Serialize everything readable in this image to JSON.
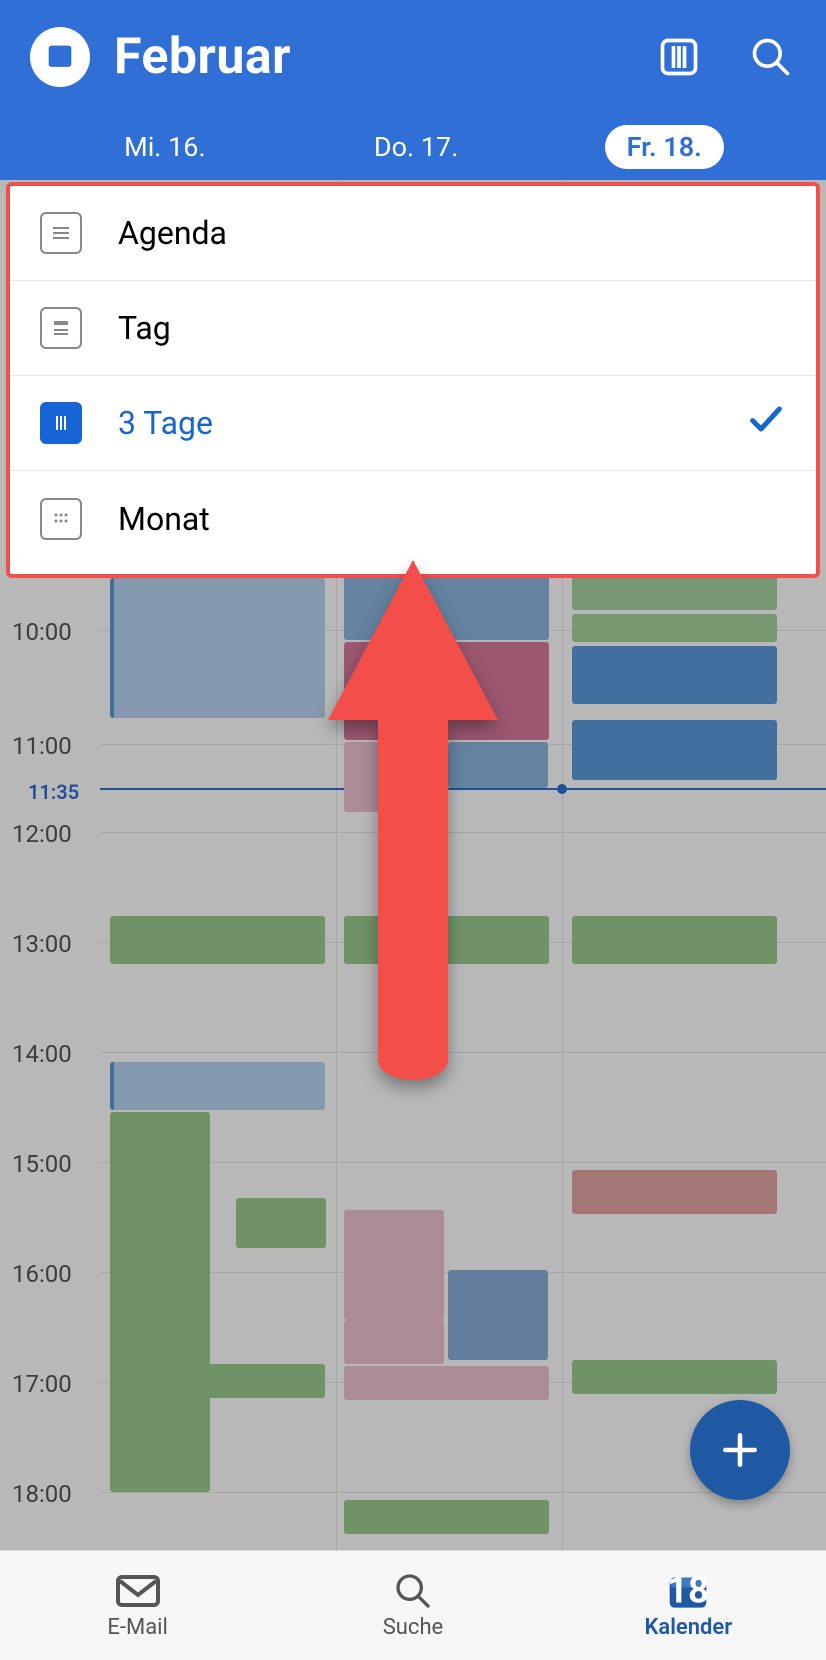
{
  "header": {
    "month": "Februar",
    "days": [
      {
        "label": "Mi. 16.",
        "active": false
      },
      {
        "label": "Do. 17.",
        "active": false
      },
      {
        "label": "Fr. 18.",
        "active": true
      }
    ]
  },
  "view_menu": {
    "items": [
      {
        "label": "Agenda",
        "selected": false,
        "icon": "agenda"
      },
      {
        "label": "Tag",
        "selected": false,
        "icon": "day"
      },
      {
        "label": "3 Tage",
        "selected": true,
        "icon": "3days"
      },
      {
        "label": "Monat",
        "selected": false,
        "icon": "month"
      }
    ]
  },
  "timeline": {
    "hours": [
      "10:00",
      "11:00",
      "12:00",
      "13:00",
      "14:00",
      "15:00",
      "16:00",
      "17:00",
      "18:00"
    ],
    "now": "11:35"
  },
  "nav": {
    "items": [
      "E-Mail",
      "Suche",
      "Kalender"
    ],
    "active_index": 2,
    "calendar_day": "18"
  }
}
